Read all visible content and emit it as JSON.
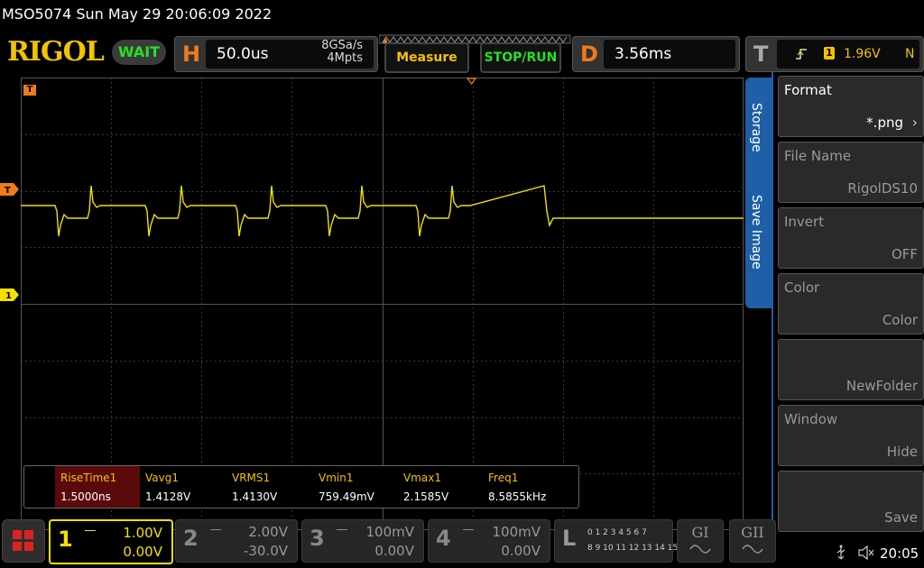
{
  "header": {
    "title": "MSO5074  Sun May 29 20:06:09 2022"
  },
  "brand": {
    "logo": "RIGOL",
    "status": "WAIT"
  },
  "horizontal": {
    "letter": "H",
    "timebase": "50.0us",
    "sample_rate": "8GSa/s",
    "memory_depth": "4Mpts"
  },
  "buttons": {
    "measure": "Measure",
    "stop_run": "STOP/RUN"
  },
  "delay": {
    "letter": "D",
    "value": "3.56ms"
  },
  "trigger": {
    "letter": "T",
    "source": "1",
    "level": "1.96V",
    "mode": "N"
  },
  "markers": {
    "trigger_marker": "T",
    "channel_marker": "1"
  },
  "side_menu": {
    "tabs": [
      "Storage",
      "Save Image"
    ],
    "items": [
      {
        "label": "Format",
        "value": "*.png"
      },
      {
        "label": "File Name",
        "value": "RigolDS10"
      },
      {
        "label": "Invert",
        "value": "OFF"
      },
      {
        "label": "Color",
        "value": "Color"
      },
      {
        "label": "",
        "value": "NewFolder"
      },
      {
        "label": "Window",
        "value": "Hide"
      },
      {
        "label": "",
        "value": "Save"
      }
    ]
  },
  "measurements": [
    {
      "name": "RiseTime1",
      "value": "1.5000ns"
    },
    {
      "name": "Vavg1",
      "value": "1.4128V"
    },
    {
      "name": "VRMS1",
      "value": "1.4130V"
    },
    {
      "name": "Vmin1",
      "value": "759.49mV"
    },
    {
      "name": "Vmax1",
      "value": "2.1585V"
    },
    {
      "name": "Freq1",
      "value": "8.5855kHz"
    }
  ],
  "channels": [
    {
      "number": "1",
      "scale": "1.00V",
      "offset": "0.00V",
      "color": "#f2e000",
      "active": true
    },
    {
      "number": "2",
      "scale": "2.00V",
      "offset": "-30.0V",
      "color": "#888888",
      "active": false
    },
    {
      "number": "3",
      "scale": "100mV",
      "offset": "0.00V",
      "color": "#888888",
      "active": false
    },
    {
      "number": "4",
      "scale": "100mV",
      "offset": "0.00V",
      "color": "#888888",
      "active": false
    }
  ],
  "logic": {
    "letter": "L",
    "row1": "0 1 2 3  4 5 6 7",
    "row2": "8 9 10 11  12 13 14 15"
  },
  "generators": [
    "GI",
    "GII"
  ],
  "clock": "20:05",
  "colors": {
    "trace": "#f2e000",
    "accent": "#f07b1a",
    "menu_blue": "#1e5fa8"
  }
}
